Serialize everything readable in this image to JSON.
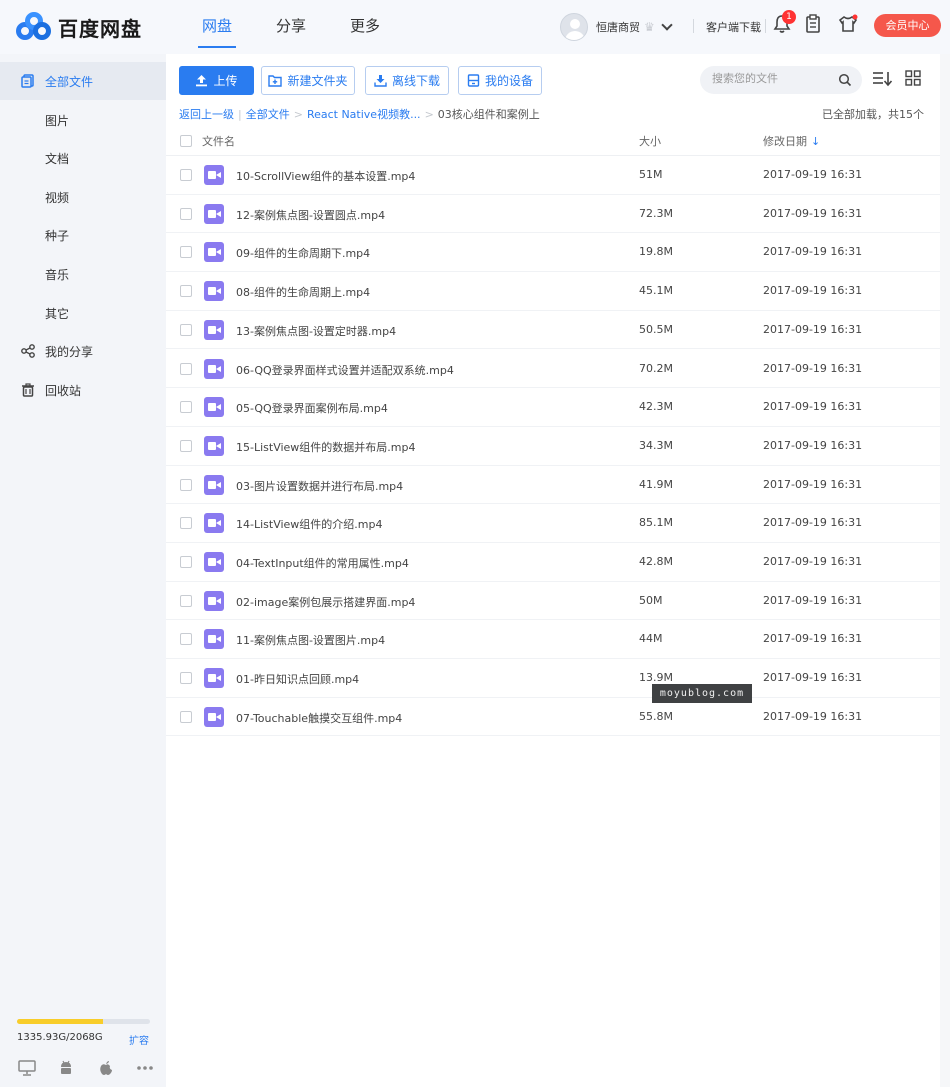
{
  "header": {
    "logo_text": "百度网盘",
    "nav": [
      "网盘",
      "分享",
      "更多"
    ],
    "username": "恒唐商贸",
    "client_download": "客户端下载",
    "notification_count": "1",
    "vip_button": "会员中心",
    "accent_color": "#2a7cf0"
  },
  "sidebar": {
    "items": [
      {
        "label": "全部文件",
        "icon": "files-icon"
      },
      {
        "label": "图片"
      },
      {
        "label": "文档"
      },
      {
        "label": "视频"
      },
      {
        "label": "种子"
      },
      {
        "label": "音乐"
      },
      {
        "label": "其它"
      },
      {
        "label": "我的分享",
        "icon": "share-icon"
      },
      {
        "label": "回收站",
        "icon": "trash-icon"
      }
    ],
    "quota_text": "1335.93G/2068G",
    "quota_fraction": 0.646,
    "expand_label": "扩容"
  },
  "toolbar": {
    "upload": "上传",
    "new_folder": "新建文件夹",
    "offline_download": "离线下载",
    "my_devices": "我的设备",
    "search_placeholder": "搜索您的文件"
  },
  "breadcrumb": {
    "back": "返回上一级",
    "all_files": "全部文件",
    "parent": "React Native视频教...",
    "current": "03核心组件和案例上",
    "loaded_status": "已全部加载，共15个"
  },
  "table": {
    "headers": {
      "name": "文件名",
      "size": "大小",
      "date": "修改日期"
    },
    "rows": [
      {
        "name": "10-ScrollView组件的基本设置.mp4",
        "size": "51M",
        "date": "2017-09-19 16:31"
      },
      {
        "name": "12-案例焦点图-设置圆点.mp4",
        "size": "72.3M",
        "date": "2017-09-19 16:31"
      },
      {
        "name": "09-组件的生命周期下.mp4",
        "size": "19.8M",
        "date": "2017-09-19 16:31"
      },
      {
        "name": "08-组件的生命周期上.mp4",
        "size": "45.1M",
        "date": "2017-09-19 16:31"
      },
      {
        "name": "13-案例焦点图-设置定时器.mp4",
        "size": "50.5M",
        "date": "2017-09-19 16:31"
      },
      {
        "name": "06-QQ登录界面样式设置并适配双系统.mp4",
        "size": "70.2M",
        "date": "2017-09-19 16:31"
      },
      {
        "name": "05-QQ登录界面案例布局.mp4",
        "size": "42.3M",
        "date": "2017-09-19 16:31"
      },
      {
        "name": "15-ListView组件的数据并布局.mp4",
        "size": "34.3M",
        "date": "2017-09-19 16:31"
      },
      {
        "name": "03-图片设置数据并进行布局.mp4",
        "size": "41.9M",
        "date": "2017-09-19 16:31"
      },
      {
        "name": "14-ListView组件的介绍.mp4",
        "size": "85.1M",
        "date": "2017-09-19 16:31"
      },
      {
        "name": "04-TextInput组件的常用属性.mp4",
        "size": "42.8M",
        "date": "2017-09-19 16:31"
      },
      {
        "name": "02-image案例包展示搭建界面.mp4",
        "size": "50M",
        "date": "2017-09-19 16:31"
      },
      {
        "name": "11-案例焦点图-设置图片.mp4",
        "size": "44M",
        "date": "2017-09-19 16:31"
      },
      {
        "name": "01-昨日知识点回顾.mp4",
        "size": "13.9M",
        "date": "2017-09-19 16:31"
      },
      {
        "name": "07-Touchable触摸交互组件.mp4",
        "size": "55.8M",
        "date": "2017-09-19 16:31"
      }
    ]
  },
  "watermark": "moyublog.com"
}
